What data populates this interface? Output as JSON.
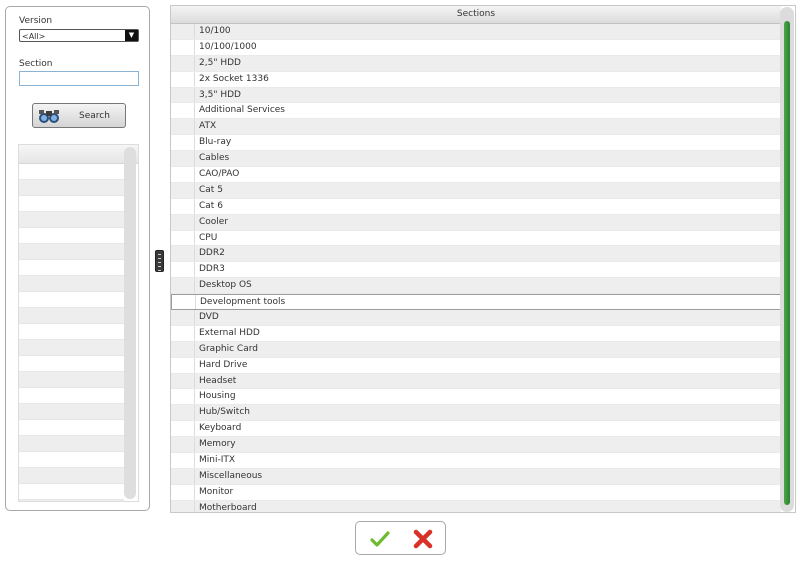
{
  "filters": {
    "version_label": "Version",
    "version_value": "<All>",
    "section_label": "Section",
    "section_value": "",
    "search_button_label": "Search"
  },
  "grid": {
    "header": "Sections",
    "selected_row": "Development tools",
    "rows": [
      "10/100",
      "10/100/1000",
      "2,5\" HDD",
      "2x Socket 1336",
      "3,5\" HDD",
      "Additional Services",
      "ATX",
      "Blu-ray",
      "Cables",
      "CAO/PAO",
      "Cat 5",
      "Cat 6",
      "Cooler",
      "CPU",
      "DDR2",
      "DDR3",
      "Desktop OS",
      "Development tools",
      "DVD",
      "External HDD",
      "Graphic Card",
      "Hard Drive",
      "Headset",
      "Housing",
      "Hub/Switch",
      "Keyboard",
      "Memory",
      "Mini-ITX",
      "Miscellaneous",
      "Monitor",
      "Motherboard"
    ]
  },
  "actions": {
    "ok_icon": "green-check-icon",
    "cancel_icon": "red-x-icon"
  },
  "colors": {
    "scroll_thumb": "#3a933a",
    "ok": "#6dbb2e",
    "cancel": "#d9302a"
  }
}
